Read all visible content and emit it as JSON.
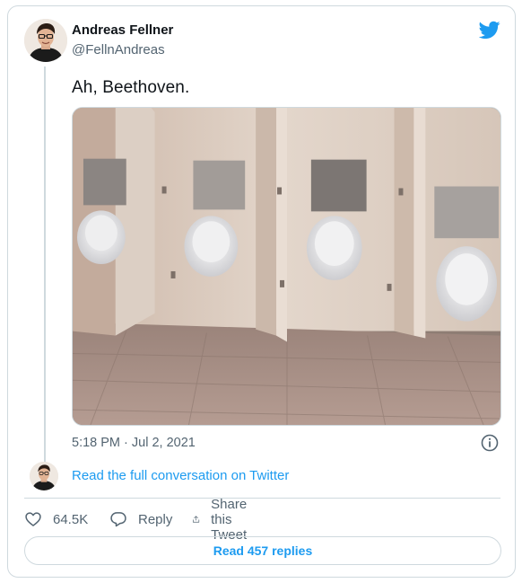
{
  "author": {
    "name": "Andreas Fellner",
    "handle": "@FellnAndreas"
  },
  "tweet": {
    "text": "Ah, Beethoven.",
    "timestamp": "5:18 PM · Jul 2, 2021"
  },
  "conversation_link": "Read the full conversation on Twitter",
  "actions": {
    "like_count": "64.5K",
    "reply_label": "Reply",
    "share_label": "Share this Tweet"
  },
  "replies_button": "Read 457 replies",
  "colors": {
    "accent": "#1d9bf0",
    "secondary_text": "#536471",
    "border": "#cfd9de"
  },
  "icons": [
    "twitter-bird-icon",
    "info-icon",
    "heart-icon",
    "reply-icon",
    "share-icon"
  ]
}
